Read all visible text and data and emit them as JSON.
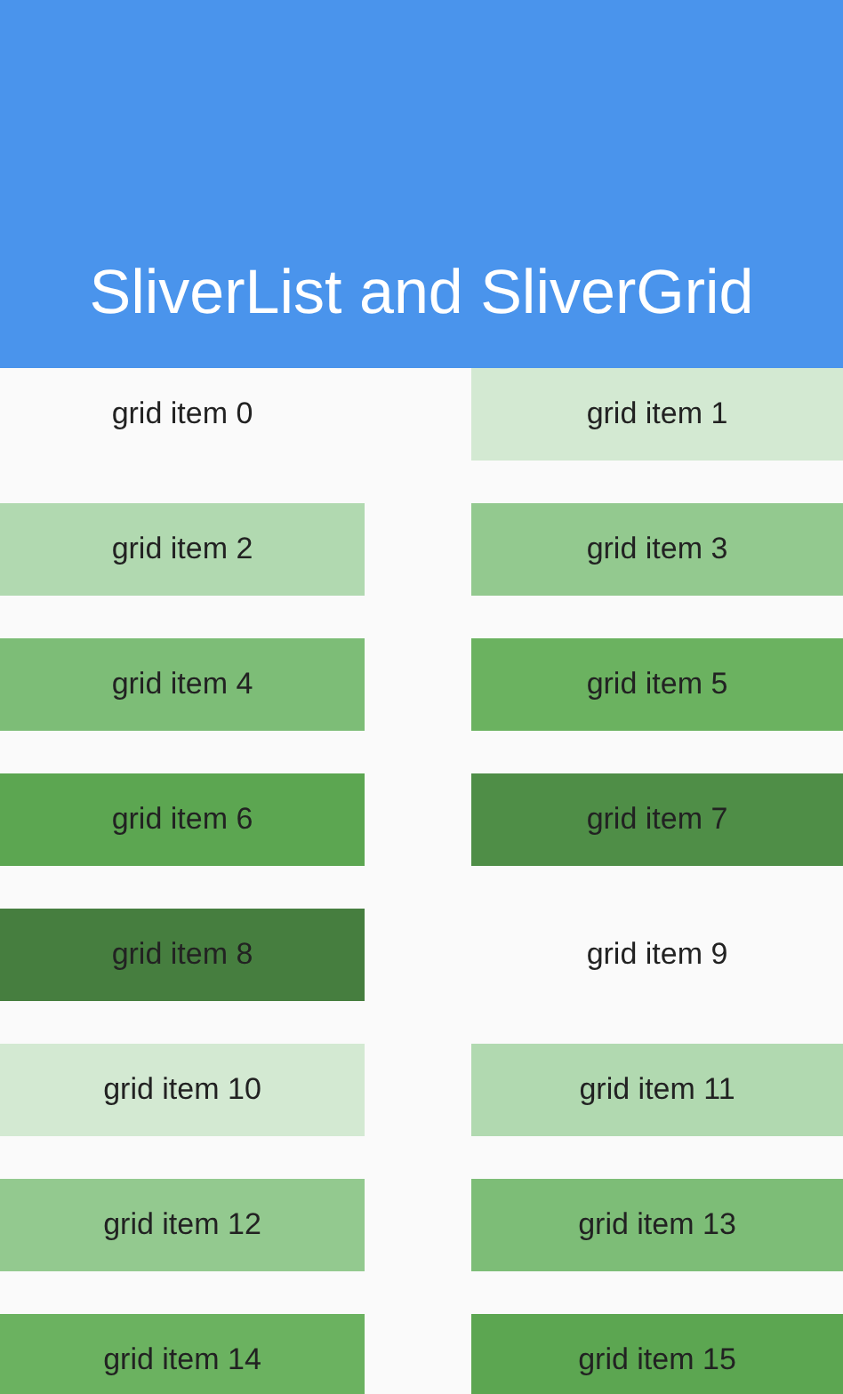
{
  "app_bar": {
    "title": "SliverList and SliverGrid"
  },
  "grid_items": [
    {
      "label": "grid item 0",
      "color": "#fafafa"
    },
    {
      "label": "grid item 1",
      "color": "#d3e9d2"
    },
    {
      "label": "grid item 2",
      "color": "#b1d9b0"
    },
    {
      "label": "grid item 3",
      "color": "#93c98f"
    },
    {
      "label": "grid item 4",
      "color": "#7dbd77"
    },
    {
      "label": "grid item 5",
      "color": "#6bb260"
    },
    {
      "label": "grid item 6",
      "color": "#5ca651"
    },
    {
      "label": "grid item 7",
      "color": "#4f8e47"
    },
    {
      "label": "grid item 8",
      "color": "#467e3f"
    },
    {
      "label": "grid item 9",
      "color": "#fafafa"
    },
    {
      "label": "grid item 10",
      "color": "#d3e9d2"
    },
    {
      "label": "grid item 11",
      "color": "#b1d9b0"
    },
    {
      "label": "grid item 12",
      "color": "#93c98f"
    },
    {
      "label": "grid item 13",
      "color": "#7dbd77"
    },
    {
      "label": "grid item 14",
      "color": "#6bb260"
    },
    {
      "label": "grid item 15",
      "color": "#5ca651"
    }
  ]
}
